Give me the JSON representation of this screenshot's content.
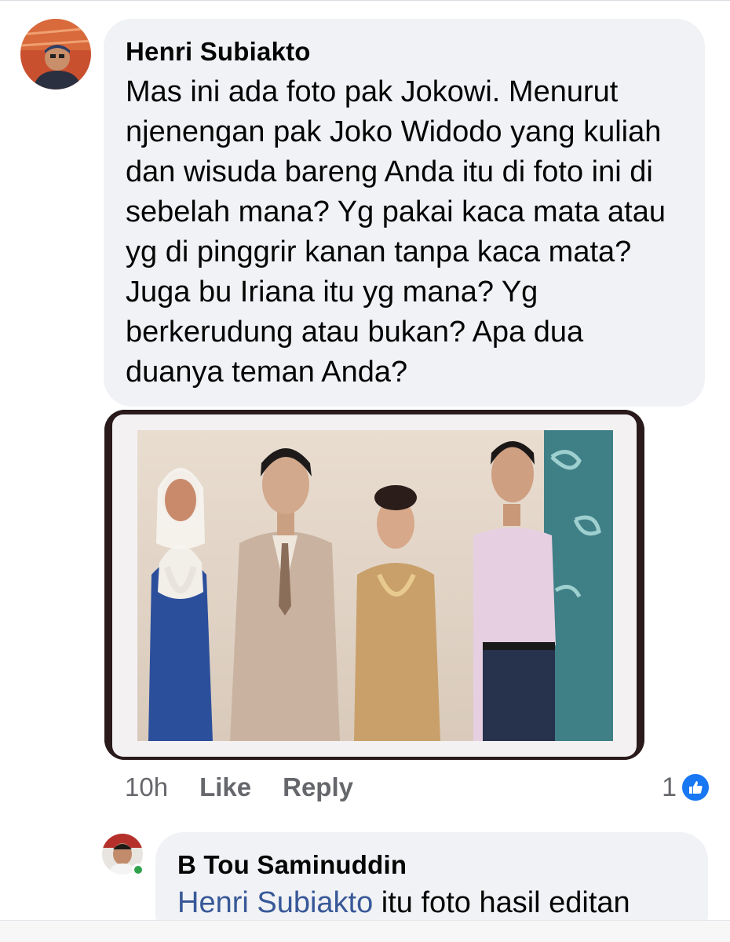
{
  "comment": {
    "author": "Henri Subiakto",
    "text": "Mas ini ada foto pak Jokowi. Menurut njenengan pak Joko Widodo yang kuliah dan wisuda bareng Anda itu di foto ini di sebelah mana? Yg pakai kaca mata atau yg di pinggrir kanan tanpa kaca mata? Juga bu Iriana itu yg mana? Yg berkerudung atau bukan? Apa dua duanya teman Anda?",
    "timestamp": "10h",
    "like_label": "Like",
    "reply_label": "Reply",
    "reaction_count": "1",
    "reaction_icon": "thumbs-up-icon"
  },
  "reply": {
    "author": "B Tou Saminuddin",
    "mention": "Henri Subiakto",
    "text": " itu foto hasil editan"
  },
  "colors": {
    "bubble": "#f0f2f5",
    "secondary_text": "#65676b",
    "mention": "#385898",
    "like_blue": "#1877f2",
    "online_green": "#31a24c"
  }
}
